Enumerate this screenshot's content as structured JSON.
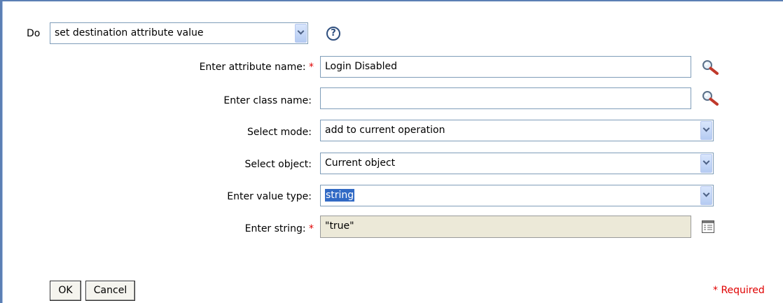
{
  "action": {
    "prefix_label": "Do",
    "selected": "set destination attribute value"
  },
  "form": {
    "attribute_name": {
      "label": "Enter attribute name:",
      "required_mark": "*",
      "value": "Login Disabled"
    },
    "class_name": {
      "label": "Enter class name:",
      "value": ""
    },
    "mode": {
      "label": "Select mode:",
      "value": "add to current operation"
    },
    "object": {
      "label": "Select object:",
      "value": "Current object"
    },
    "value_type": {
      "label": "Enter value type:",
      "value": "string"
    },
    "string": {
      "label": "Enter string:",
      "required_mark": "*",
      "value": "\"true\""
    }
  },
  "buttons": {
    "ok": "OK",
    "cancel": "Cancel"
  },
  "required_note": "* Required",
  "icons": {
    "help": "help-icon",
    "browse_attribute": "magnifier-icon",
    "browse_class": "magnifier-icon",
    "argument_builder": "argument-builder-icon"
  },
  "colors": {
    "frame": "#5b7fb4",
    "required": "#e00000",
    "selection": "#316ac5",
    "readonly_bg": "#ece9d8"
  }
}
